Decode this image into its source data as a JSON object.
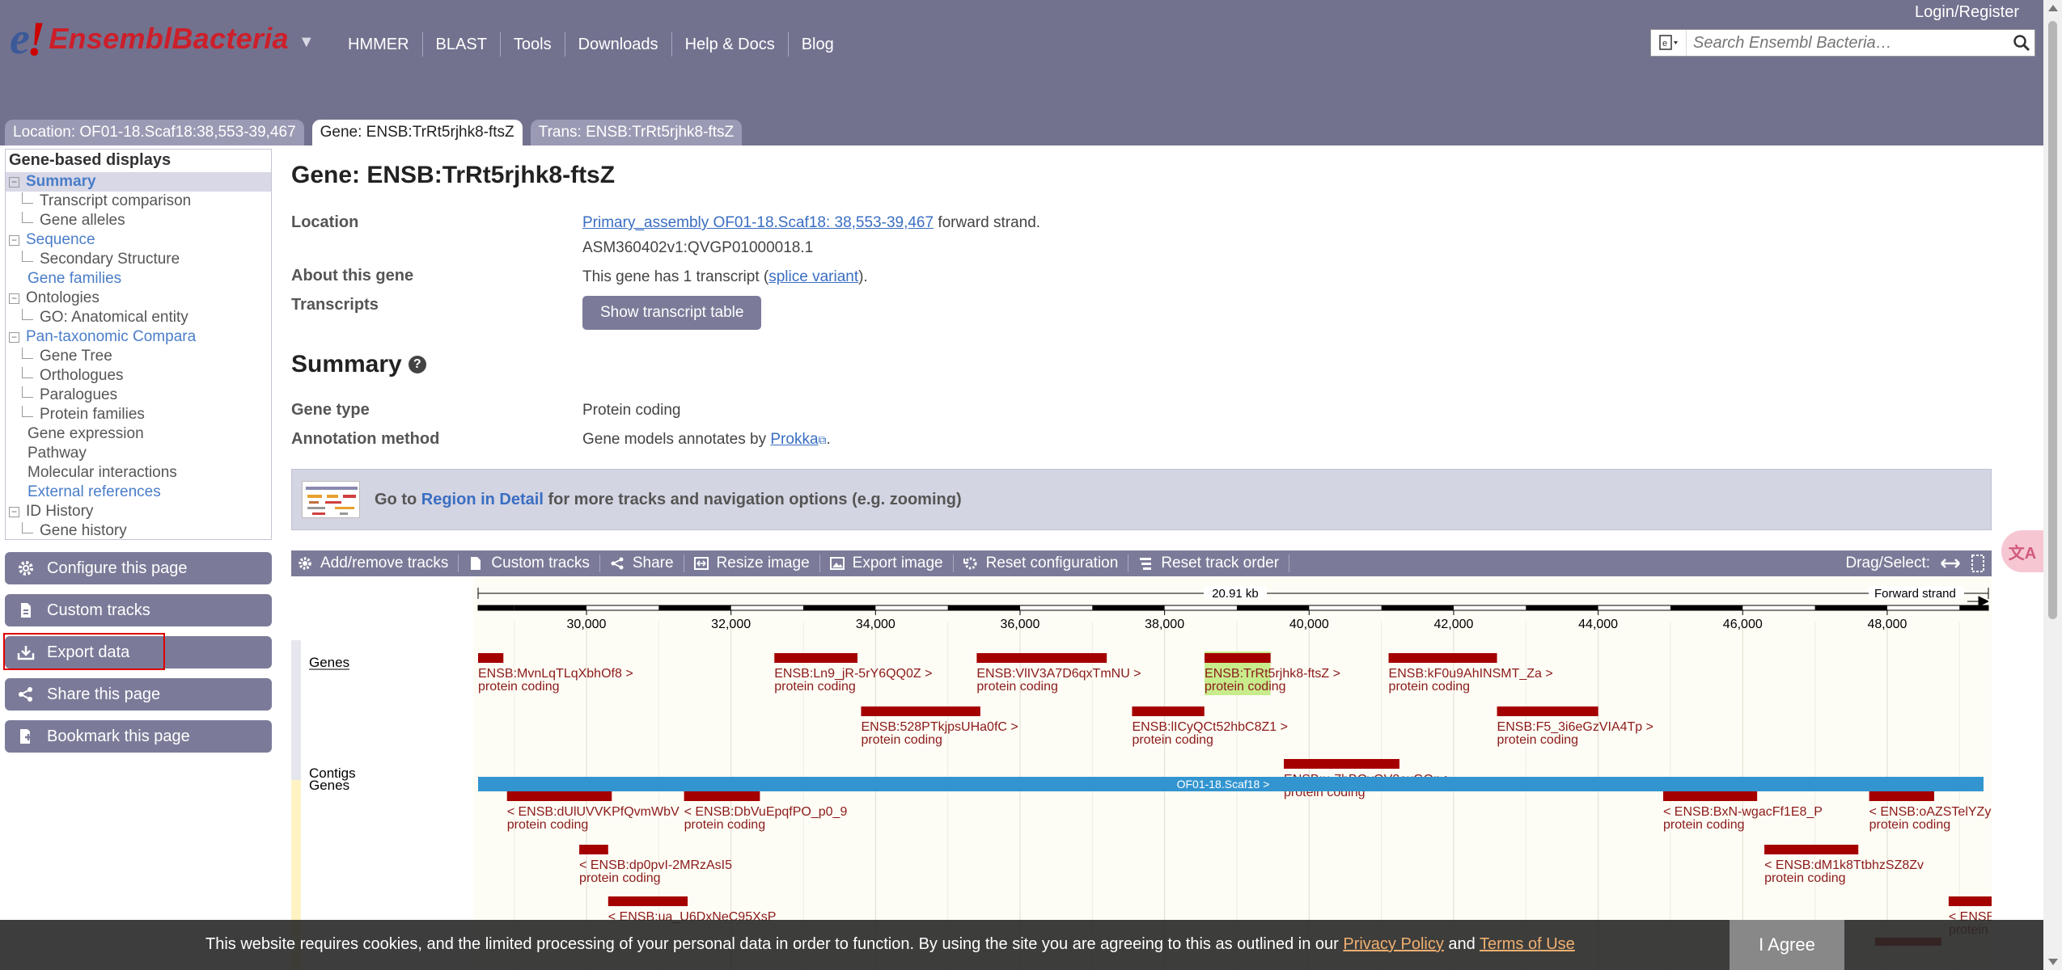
{
  "header": {
    "logo_e": "e",
    "logo_bang": "!",
    "logo_name": "EnsemblBacteria",
    "nav": [
      "HMMER",
      "BLAST",
      "Tools",
      "Downloads",
      "Help & Docs",
      "Blog"
    ],
    "login": "Login/Register",
    "search_placeholder": "Search Ensembl Bacteria…"
  },
  "tabs": [
    {
      "label": "Location: OF01-18.Scaf18:38,553-39,467",
      "active": false
    },
    {
      "label": "Gene: ENSB:TrRt5rjhk8-ftsZ",
      "active": true
    },
    {
      "label": "Trans: ENSB:TrRt5rjhk8-ftsZ",
      "active": false
    }
  ],
  "sidebar": {
    "heading": "Gene-based displays",
    "items": [
      {
        "label": "Summary",
        "level": 0,
        "box": "⊟",
        "style": "link",
        "selected": true
      },
      {
        "label": "Transcript comparison",
        "level": 1,
        "style": "plain"
      },
      {
        "label": "Gene alleles",
        "level": 1,
        "style": "plain"
      },
      {
        "label": "Sequence",
        "level": 0,
        "box": "⊟",
        "style": "link"
      },
      {
        "label": "Secondary Structure",
        "level": 1,
        "style": "plain"
      },
      {
        "label": "Gene families",
        "level": 0,
        "style": "link"
      },
      {
        "label": "Ontologies",
        "level": 0,
        "box": "⊟",
        "style": "plain"
      },
      {
        "label": "GO: Anatomical entity",
        "level": 1,
        "style": "plain"
      },
      {
        "label": "Pan-taxonomic Compara",
        "level": 0,
        "box": "⊟",
        "style": "link"
      },
      {
        "label": "Gene Tree",
        "level": 1,
        "style": "plain"
      },
      {
        "label": "Orthologues",
        "level": 1,
        "style": "plain"
      },
      {
        "label": "Paralogues",
        "level": 1,
        "style": "plain"
      },
      {
        "label": "Protein families",
        "level": 1,
        "style": "plain"
      },
      {
        "label": "Gene expression",
        "level": 0,
        "style": "plain"
      },
      {
        "label": "Pathway",
        "level": 0,
        "style": "plain"
      },
      {
        "label": "Molecular interactions",
        "level": 0,
        "style": "plain"
      },
      {
        "label": "External references",
        "level": 0,
        "style": "link"
      },
      {
        "label": "ID History",
        "level": 0,
        "box": "⊟",
        "style": "plain"
      },
      {
        "label": "Gene history",
        "level": 1,
        "style": "plain"
      }
    ],
    "buttons": [
      {
        "label": "Configure this page",
        "icon": "gear-icon"
      },
      {
        "label": "Custom tracks",
        "icon": "custom-tracks-icon"
      },
      {
        "label": "Export data",
        "icon": "export-icon"
      },
      {
        "label": "Share this page",
        "icon": "share-icon"
      },
      {
        "label": "Bookmark this page",
        "icon": "bookmark-icon"
      }
    ]
  },
  "gene": {
    "title": "Gene: ENSB:TrRt5rjhk8-ftsZ",
    "location_label": "Location",
    "location_link": "Primary_assembly OF01-18.Scaf18: 38,553-39,467",
    "location_suffix": " forward strand.",
    "assembly": "ASM360402v1:QVGP01000018.1",
    "about_label": "About this gene",
    "about_prefix": "This gene has 1 transcript (",
    "about_link": "splice variant",
    "about_suffix": ").",
    "transcripts_label": "Transcripts",
    "show_transcript_table": "Show transcript table"
  },
  "summary": {
    "heading": "Summary",
    "help_glyph": "?",
    "gene_type_label": "Gene type",
    "gene_type_value": "Protein coding",
    "annotation_label": "Annotation method",
    "annotation_prefix": "Gene models annotates by ",
    "annotation_link": "Prokka",
    "annotation_suffix": "."
  },
  "region_banner": {
    "prefix": "Go to ",
    "link": "Region in Detail",
    "suffix": " for more tracks and navigation options (e.g. zooming)"
  },
  "toolbar": {
    "items": [
      {
        "label": "Add/remove tracks",
        "icon": "gear-icon"
      },
      {
        "label": "Custom tracks",
        "icon": "custom-tracks-icon"
      },
      {
        "label": "Share",
        "icon": "share-icon"
      },
      {
        "label": "Resize image",
        "icon": "resize-icon"
      },
      {
        "label": "Export image",
        "icon": "export-image-icon"
      },
      {
        "label": "Reset configuration",
        "icon": "reset-config-icon"
      },
      {
        "label": "Reset track order",
        "icon": "reset-order-icon"
      }
    ],
    "drag_select": "Drag/Select:"
  },
  "genome_image": {
    "scale_label": "20.91 kb",
    "strand_label": "Forward strand",
    "ruler_ticks": [
      "30,000",
      "32,000",
      "34,000",
      "36,000",
      "38,000",
      "40,000",
      "42,000",
      "44,000",
      "46,000",
      "48,000"
    ],
    "track_genes_label": "Genes",
    "track_contigs_label": "Contigs",
    "contig_label": "OF01-18.Scaf18 >",
    "colors": {
      "gene": "#a50000",
      "highlight": "#c8ec8c",
      "contig": "#3395d0"
    },
    "forward_genes": [
      {
        "name": "ENSB:MvnLqTLqXbhOf8 >",
        "sub": "protein coding"
      },
      {
        "name": "ENSB:Ln9_jR-5rY6QQ0Z >",
        "sub": "protein coding"
      },
      {
        "name": "ENSB:VlIV3A7D6qxTmNU >",
        "sub": "protein coding"
      },
      {
        "name": "ENSB:TrRt5rjhk8-ftsZ >",
        "sub": "protein coding",
        "highlight": true
      },
      {
        "name": "ENSB:kF0u9AhINSMT_Za >",
        "sub": "protein coding"
      },
      {
        "name": "ENSB:528PTkjpsUHa0fC >",
        "sub": "protein coding"
      },
      {
        "name": "ENSB:lICyQCt52hbC8Z1 >",
        "sub": "protein coding"
      },
      {
        "name": "ENSB:F5_3i6eGzVIA4Tp >",
        "sub": "protein coding"
      },
      {
        "name": "ENSB:u-7bBQvQV2exGQn >",
        "sub": "protein coding"
      }
    ],
    "reverse_genes": [
      {
        "name": "< ENSB:dUlUVVKPfQvmWbV",
        "sub": "protein coding"
      },
      {
        "name": "< ENSB:DbVuEpqfPO_p0_9",
        "sub": "protein coding"
      },
      {
        "name": "< ENSB:BxN-wgacFf1E8_P",
        "sub": "protein coding"
      },
      {
        "name": "< ENSB:oAZSTelYZynOdNV",
        "sub": "protein coding"
      },
      {
        "name": "< ENSB:dp0pvI-2MRzAsI5",
        "sub": "protein coding"
      },
      {
        "name": "< ENSB:dM1k8TtbhzSZ8Zv",
        "sub": "protein coding"
      },
      {
        "name": "< ENSB:ua_U6DxNeC95XsP",
        "sub": ""
      },
      {
        "name": "< ENSB:",
        "sub": "protein c"
      }
    ]
  },
  "cookie": {
    "text": "This website requires cookies, and the limited processing of your personal data in order to function. By using the site you are agreeing to this as outlined in our ",
    "privacy": "Privacy Policy",
    "and": " and ",
    "terms": "Terms of Use",
    "agree": "I Agree"
  },
  "translate_glyph": "文A"
}
